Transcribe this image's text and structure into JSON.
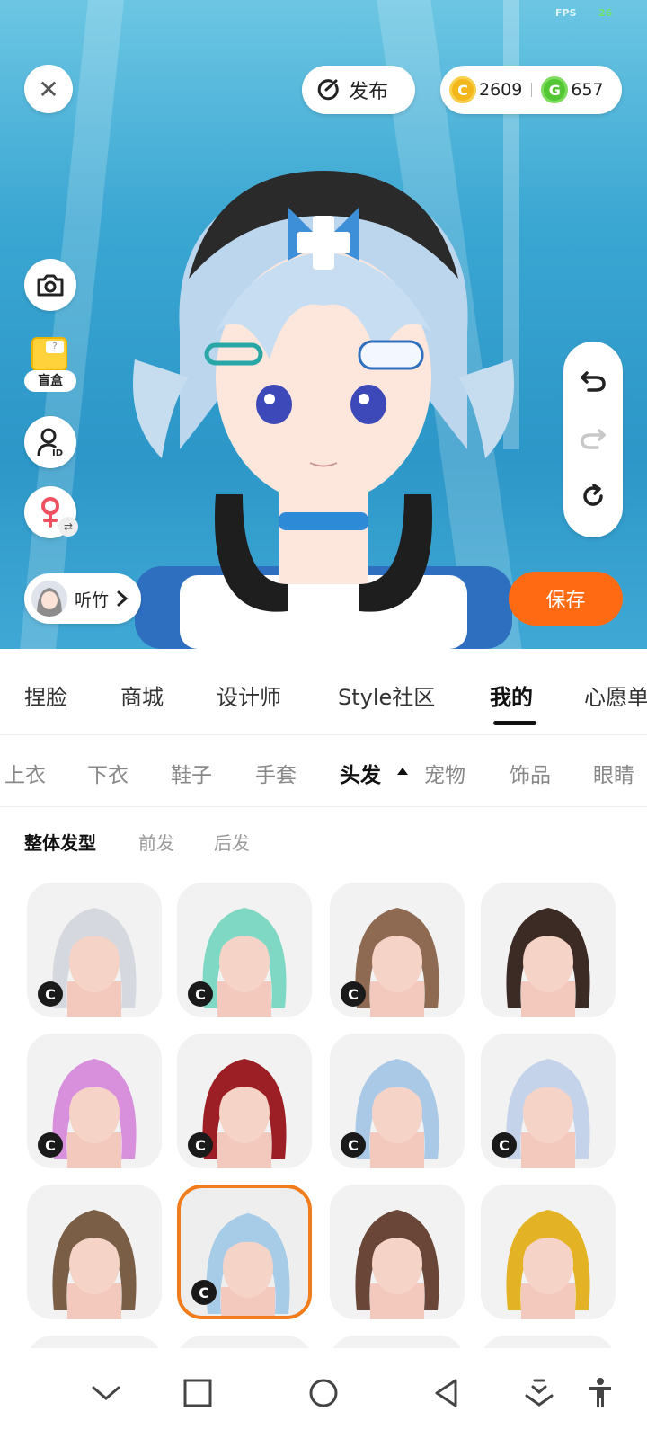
{
  "viewport": {
    "fps_label": "FPS",
    "fps_value": "26",
    "publish_label": "发布",
    "coin_gold_symbol": "C",
    "coin_gold_value": "2609",
    "coin_green_symbol": "G",
    "coin_green_value": "657",
    "blind_box_label": "盲盒",
    "profile_name": "听竹",
    "save_label": "保存"
  },
  "main_tabs": [
    "捏脸",
    "商城",
    "设计师",
    "Style社区",
    "我的",
    "心愿单"
  ],
  "main_tab_active": "我的",
  "sub_tabs": [
    "上衣",
    "下衣",
    "鞋子",
    "手套",
    "头发",
    "宠物",
    "饰品",
    "眼睛"
  ],
  "sub_tab_active": "头发",
  "style_filters": [
    "整体发型",
    "前发",
    "后发"
  ],
  "style_filter_active": "整体发型",
  "hair_items": [
    {
      "color": "#d5d8de",
      "badge": "C"
    },
    {
      "color": "#7fd8c4",
      "badge": "C"
    },
    {
      "color": "#8e6a52",
      "badge": "C"
    },
    {
      "color": "#3c2a24",
      "badge": ""
    },
    {
      "color": "#d88fdc",
      "badge": "C"
    },
    {
      "color": "#9c1f25",
      "badge": "C"
    },
    {
      "color": "#a9c9e6",
      "badge": "C"
    },
    {
      "color": "#c5d3ea",
      "badge": "C"
    },
    {
      "color": "#7a5e45",
      "badge": ""
    },
    {
      "color": "#a7cce8",
      "badge": "C"
    },
    {
      "color": "#6a4638",
      "badge": ""
    },
    {
      "color": "#e4b325",
      "badge": ""
    }
  ],
  "selected_hair_index": 9,
  "colors": {
    "accent": "#ff6a13",
    "selected_border": "#f07c1c"
  }
}
